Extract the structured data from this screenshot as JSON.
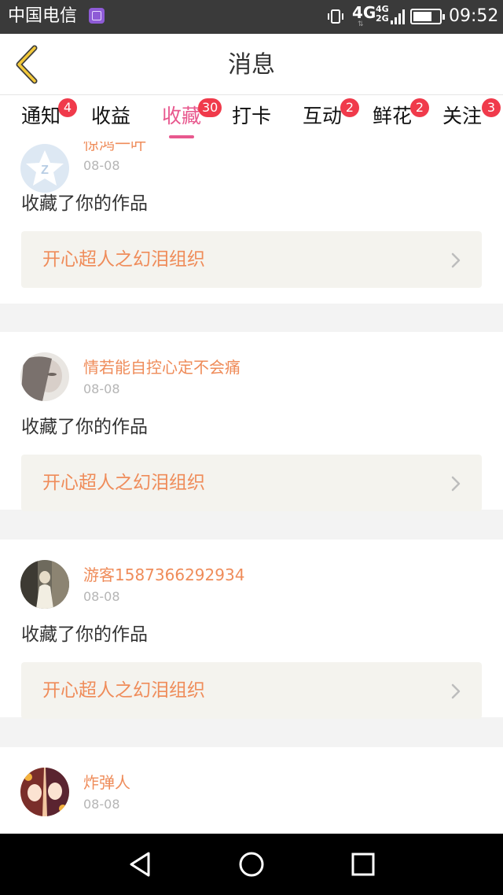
{
  "status_bar": {
    "carrier": "中国电信",
    "network": "4G",
    "dual_sim": [
      "4G",
      "2G"
    ],
    "battery_level": 0.72,
    "time": "09:52",
    "icons": [
      "app-notification-icon",
      "vibrate-icon",
      "signal-icon",
      "battery-icon"
    ]
  },
  "header": {
    "title": "消息",
    "back_icon": "chevron-left-icon"
  },
  "tabs": [
    {
      "label": "通知",
      "badge": "4"
    },
    {
      "label": "收益",
      "badge": ""
    },
    {
      "label": "收藏",
      "badge": "30",
      "active": true
    },
    {
      "label": "打卡",
      "badge": ""
    },
    {
      "label": "互动",
      "badge": "2"
    },
    {
      "label": "鲜花",
      "badge": "2"
    },
    {
      "label": "关注",
      "badge": "3"
    }
  ],
  "colors": {
    "accent": "#e8588e",
    "badge": "#f03a4b",
    "username": "#ef8c5a",
    "work_box": "#f4f3ee"
  },
  "messages": [
    {
      "username": "惊鸿一叶",
      "date": "08-08",
      "action": "收藏了你的作品",
      "work_title": "开心超人之幻泪组织"
    },
    {
      "username": "情若能自控心定不会痛",
      "date": "08-08",
      "action": "收藏了你的作品",
      "work_title": "开心超人之幻泪组织"
    },
    {
      "username": "游客1587366292934",
      "date": "08-08",
      "action": "收藏了你的作品",
      "work_title": "开心超人之幻泪组织"
    },
    {
      "username": "炸弹人",
      "date": "08-08",
      "action": "",
      "work_title": ""
    }
  ],
  "nav_bar": {
    "icons": [
      "back-triangle-icon",
      "home-circle-icon",
      "recents-square-icon"
    ]
  }
}
